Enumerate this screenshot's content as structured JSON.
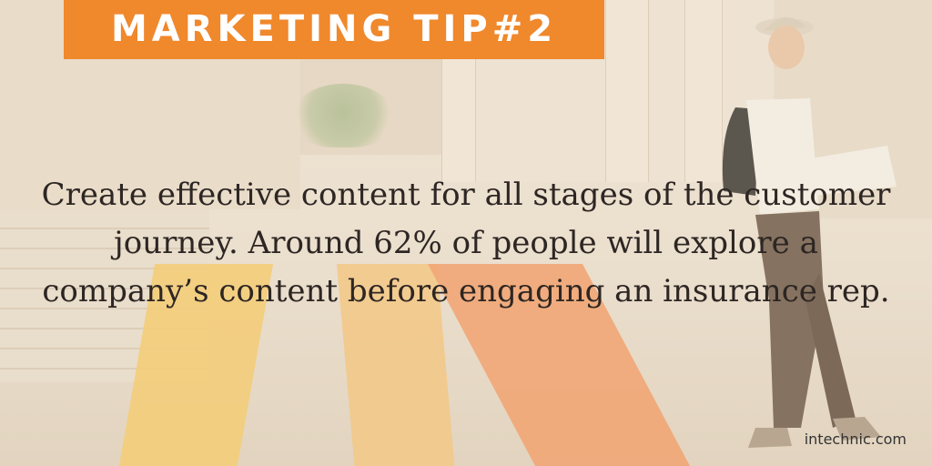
{
  "badge": {
    "text": "MARKETING TIP#2"
  },
  "body": {
    "lines": [
      "Create effective content for all stages of the customer",
      "journey. Around 62% of people will explore a",
      "company’s content before engaging an insurance rep."
    ]
  },
  "footer": {
    "site": "intechnic.com"
  },
  "colors": {
    "badge": "#f0882c",
    "text": "#2d2623",
    "carpet_yellow": "#f3cd7c",
    "carpet_orange": "#f1a676"
  }
}
